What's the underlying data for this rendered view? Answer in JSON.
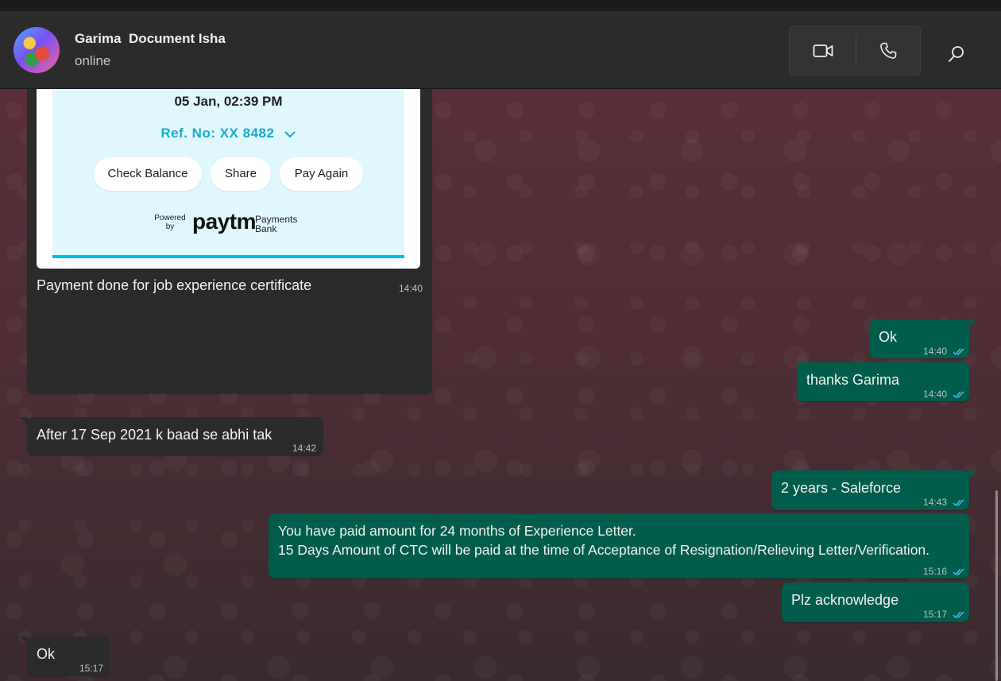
{
  "header": {
    "contact_name": "Garima  Document Isha",
    "status": "online"
  },
  "receipt": {
    "date": "05 Jan, 02:39 PM",
    "ref": "Ref. No: XX 8482",
    "check_balance": "Check Balance",
    "share": "Share",
    "pay_again": "Pay Again",
    "powered_by": "Powered by",
    "brand": "paytm",
    "bank_text": "Payments Bank"
  },
  "messages": [
    {
      "text": "Payment done for job experience certificate",
      "time": "14:40"
    },
    {
      "text": "Ok",
      "time": "14:40"
    },
    {
      "text": "thanks Garima",
      "time": "14:40"
    },
    {
      "text": "After 17 Sep 2021 k baad se abhi tak",
      "time": "14:42"
    },
    {
      "text": "2 years - Saleforce",
      "time": "14:43"
    },
    {
      "text": "You have paid amount for 24 months of Experience Letter.\n15 Days Amount of CTC will be paid at the time of Acceptance of Resignation/Relieving Letter/Verification.",
      "time": "15:16"
    },
    {
      "text": "Plz acknowledge",
      "time": "15:17"
    },
    {
      "text": "Ok",
      "time": "15:17"
    }
  ],
  "colors": {
    "outgoing_bubble": "#005c4b",
    "incoming_bubble": "#2b2b2b",
    "read_ticks": "#53bdeb"
  },
  "icons": [
    "video-call-icon",
    "voice-call-icon",
    "search-icon",
    "double-check-icon",
    "chevron-down-icon"
  ]
}
